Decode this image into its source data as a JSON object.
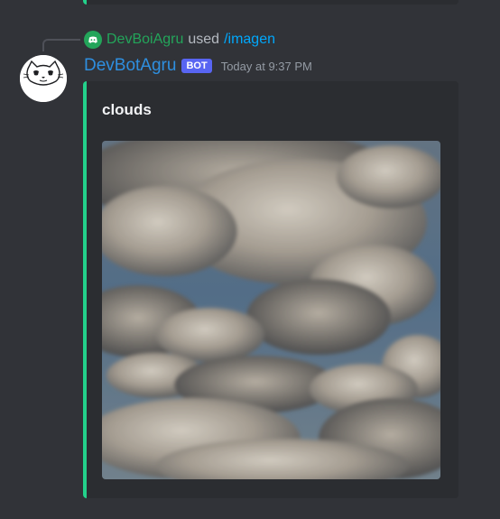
{
  "interaction": {
    "user_name": "DevBoiAgru",
    "used_text": "used",
    "command": "/imagen"
  },
  "message": {
    "author": "DevBotAgru",
    "badge": "BOT",
    "timestamp": "Today at 9:37 PM"
  },
  "embed": {
    "title": "clouds",
    "accent_color": "#23d18b",
    "image_icon": "cloudy-sky-image"
  },
  "colors": {
    "background": "#313338",
    "embed_background": "#2b2d31",
    "author_color": "#2e8fe0",
    "badge_color": "#5865f2",
    "command_color": "#00a8fc",
    "interaction_user_color": "#23a55a"
  }
}
